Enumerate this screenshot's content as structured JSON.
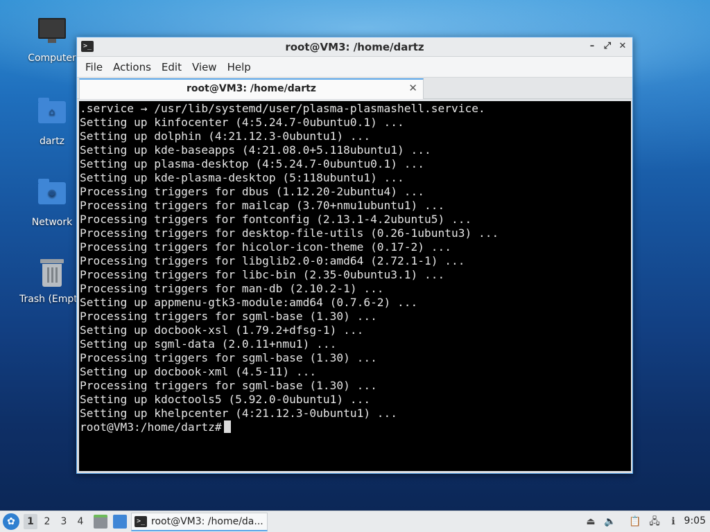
{
  "desktop": {
    "icons": [
      {
        "label": "Computer",
        "icon": "computer-icon"
      },
      {
        "label": "dartz",
        "icon": "home-folder-icon"
      },
      {
        "label": "Network",
        "icon": "network-folder-icon"
      },
      {
        "label": "Trash (Empty)",
        "icon": "trash-icon"
      }
    ]
  },
  "window": {
    "title": "root@VM3: /home/dartz",
    "controls": [
      "minimize-icon",
      "maximize-icon",
      "close-icon"
    ],
    "menu": [
      "File",
      "Actions",
      "Edit",
      "View",
      "Help"
    ],
    "tab": {
      "label": "root@VM3: /home/dartz"
    },
    "terminal": {
      "lines": [
        ".service → /usr/lib/systemd/user/plasma-plasmashell.service.",
        "Setting up kinfocenter (4:5.24.7-0ubuntu0.1) ...",
        "Setting up dolphin (4:21.12.3-0ubuntu1) ...",
        "Setting up kde-baseapps (4:21.08.0+5.118ubuntu1) ...",
        "Setting up plasma-desktop (4:5.24.7-0ubuntu0.1) ...",
        "Setting up kde-plasma-desktop (5:118ubuntu1) ...",
        "Processing triggers for dbus (1.12.20-2ubuntu4) ...",
        "Processing triggers for mailcap (3.70+nmu1ubuntu1) ...",
        "Processing triggers for fontconfig (2.13.1-4.2ubuntu5) ...",
        "Processing triggers for desktop-file-utils (0.26-1ubuntu3) ...",
        "Processing triggers for hicolor-icon-theme (0.17-2) ...",
        "Processing triggers for libglib2.0-0:amd64 (2.72.1-1) ...",
        "Processing triggers for libc-bin (2.35-0ubuntu3.1) ...",
        "Processing triggers for man-db (2.10.2-1) ...",
        "Setting up appmenu-gtk3-module:amd64 (0.7.6-2) ...",
        "Processing triggers for sgml-base (1.30) ...",
        "Setting up docbook-xsl (1.79.2+dfsg-1) ...",
        "Setting up sgml-data (2.0.11+nmu1) ...",
        "Processing triggers for sgml-base (1.30) ...",
        "Setting up docbook-xml (4.5-11) ...",
        "Processing triggers for sgml-base (1.30) ...",
        "Setting up kdoctools5 (5.92.0-0ubuntu1) ...",
        "Setting up khelpcenter (4:21.12.3-0ubuntu1) ..."
      ],
      "prompt": "root@VM3:/home/dartz#"
    }
  },
  "taskbar": {
    "start_icon": "lxqt-menu-icon",
    "workspaces": [
      "1",
      "2",
      "3",
      "4"
    ],
    "active_workspace": "1",
    "quicklaunch": [
      "file-manager-icon",
      "show-desktop-icon"
    ],
    "task": {
      "label": "root@VM3: /home/da..."
    },
    "tray": [
      "eject-icon",
      "volume-icon",
      "clipboard-icon",
      "network-icon",
      "notification-icon"
    ],
    "clock": "9:05"
  },
  "colors": {
    "accent": "#5aa6e8",
    "terminal_bg": "#000000",
    "terminal_fg": "#e6e6e6"
  }
}
